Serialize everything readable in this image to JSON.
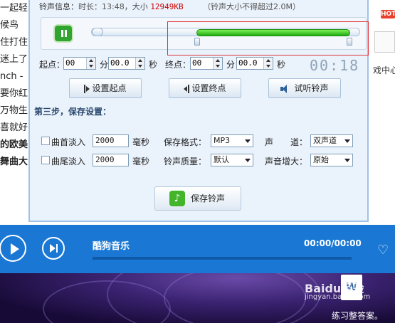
{
  "background": {
    "list_items": [
      {
        "text": "一起轻",
        "bold": false
      },
      {
        "text": "候鸟",
        "bold": false
      },
      {
        "text": "住打住",
        "bold": false
      },
      {
        "text": "迷上了",
        "bold": false
      },
      {
        "text": "nch -",
        "bold": false
      },
      {
        "text": "要你红",
        "bold": false
      },
      {
        "text": "万物生",
        "bold": false
      },
      {
        "text": "喜就好",
        "bold": false
      },
      {
        "text": "的欧美",
        "bold": true
      },
      {
        "text": "舞曲大",
        "bold": true
      }
    ],
    "right_badge": "HOT",
    "right_label": "戏中心"
  },
  "dialog": {
    "info_label": "铃声信息：",
    "duration_text": "时长：13:48，大小",
    "size_value": "12949KB",
    "size_note": "（铃声大小不得超过2.0M）",
    "start_label": "起点：",
    "end_label": "终点：",
    "start_min": "00",
    "start_sec": "00.0",
    "end_min": "00",
    "end_sec": "00.0",
    "min_unit": "分",
    "sec_unit": "秒",
    "time_display": "00:18",
    "set_start_button": "设置起点",
    "set_end_button": "设置终点",
    "preview_button": "试听铃声",
    "step3_title": "第三步，保存设置：",
    "fade_in_label": "曲首淡入",
    "fade_out_label": "曲尾淡入",
    "fade_in_value": "2000",
    "fade_out_value": "2000",
    "ms_unit": "毫秒",
    "format_label": "保存格式：",
    "format_value": "MP3",
    "quality_label": "铃声质量：",
    "quality_value": "默认",
    "channel_label": "声　　道：",
    "channel_value": "双声道",
    "volume_label": "声音增大：",
    "volume_value": "原始",
    "save_button": "保存铃声",
    "selection": {
      "start_fraction": 0.39,
      "end_fraction": 0.96
    }
  },
  "player": {
    "title": "酷狗音乐",
    "time": "00:00/00:00",
    "progress": 0
  },
  "watermark": {
    "brand": "Baidu经验",
    "url": "jingyan.baidu.com",
    "caption": "练习整答案。"
  },
  "colors": {
    "accent": "#1a78d4",
    "selection_fill": "#2fc21d",
    "highlight_border": "#e0323a",
    "size_red": "#cc0000"
  }
}
